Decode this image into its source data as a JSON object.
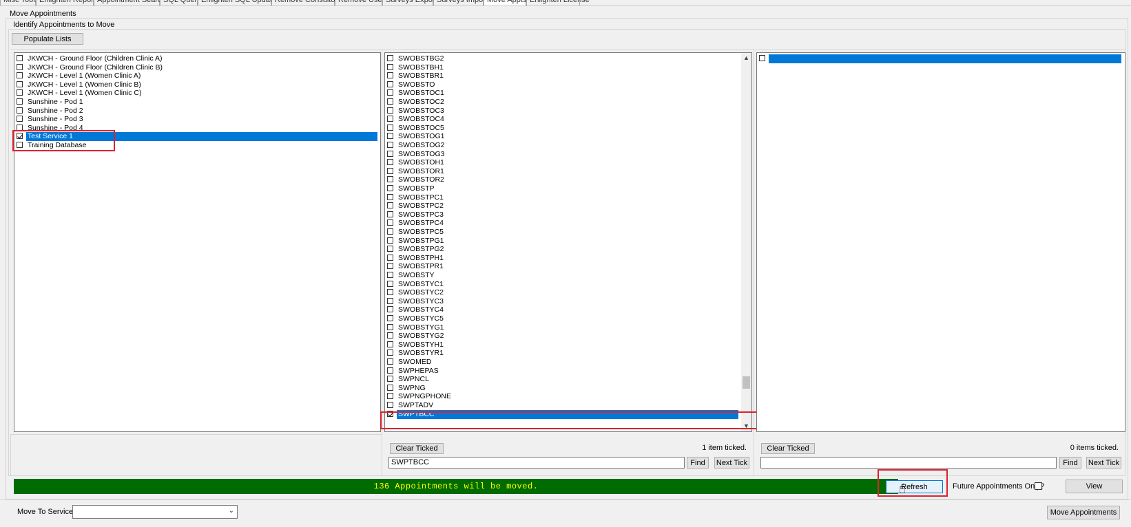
{
  "tabs": [
    {
      "label": "Misc Tools"
    },
    {
      "label": "Enlighten Reports"
    },
    {
      "label": "Appointment Search"
    },
    {
      "label": "SQL Query"
    },
    {
      "label": "Enlighten SQL Updates"
    },
    {
      "label": "Remove Consultors"
    },
    {
      "label": "Remove Users"
    },
    {
      "label": "Surveys Export"
    },
    {
      "label": "Surveys Import"
    },
    {
      "label": "Move Appts"
    },
    {
      "label": "Enlighten License"
    }
  ],
  "outer_group_title": "Move Appointments",
  "inner_group_title": "Identify Appointments to Move",
  "populate_button": "Populate Lists",
  "services": [
    {
      "label": "JKWCH - Ground Floor (Children Clinic A)",
      "checked": false
    },
    {
      "label": "JKWCH - Ground Floor (Children Clinic B)",
      "checked": false
    },
    {
      "label": "JKWCH - Level 1 (Women Clinic A)",
      "checked": false
    },
    {
      "label": "JKWCH - Level 1 (Women Clinic B)",
      "checked": false
    },
    {
      "label": "JKWCH - Level 1 (Women Clinic C)",
      "checked": false
    },
    {
      "label": "Sunshine - Pod 1",
      "checked": false
    },
    {
      "label": "Sunshine - Pod 2",
      "checked": false
    },
    {
      "label": "Sunshine - Pod 3",
      "checked": false
    },
    {
      "label": "Sunshine - Pod 4",
      "checked": false
    },
    {
      "label": "Test Service 1",
      "checked": true,
      "selected": true
    },
    {
      "label": "Training Database",
      "checked": false
    }
  ],
  "clinics": [
    {
      "label": "SWOBSTBG2",
      "checked": false
    },
    {
      "label": "SWOBSTBH1",
      "checked": false
    },
    {
      "label": "SWOBSTBR1",
      "checked": false
    },
    {
      "label": "SWOBSTO",
      "checked": false
    },
    {
      "label": "SWOBSTOC1",
      "checked": false
    },
    {
      "label": "SWOBSTOC2",
      "checked": false
    },
    {
      "label": "SWOBSTOC3",
      "checked": false
    },
    {
      "label": "SWOBSTOC4",
      "checked": false
    },
    {
      "label": "SWOBSTOC5",
      "checked": false
    },
    {
      "label": "SWOBSTOG1",
      "checked": false
    },
    {
      "label": "SWOBSTOG2",
      "checked": false
    },
    {
      "label": "SWOBSTOG3",
      "checked": false
    },
    {
      "label": "SWOBSTOH1",
      "checked": false
    },
    {
      "label": "SWOBSTOR1",
      "checked": false
    },
    {
      "label": "SWOBSTOR2",
      "checked": false
    },
    {
      "label": "SWOBSTP",
      "checked": false
    },
    {
      "label": "SWOBSTPC1",
      "checked": false
    },
    {
      "label": "SWOBSTPC2",
      "checked": false
    },
    {
      "label": "SWOBSTPC3",
      "checked": false
    },
    {
      "label": "SWOBSTPC4",
      "checked": false
    },
    {
      "label": "SWOBSTPC5",
      "checked": false
    },
    {
      "label": "SWOBSTPG1",
      "checked": false
    },
    {
      "label": "SWOBSTPG2",
      "checked": false
    },
    {
      "label": "SWOBSTPH1",
      "checked": false
    },
    {
      "label": "SWOBSTPR1",
      "checked": false
    },
    {
      "label": "SWOBSTY",
      "checked": false
    },
    {
      "label": "SWOBSTYC1",
      "checked": false
    },
    {
      "label": "SWOBSTYC2",
      "checked": false
    },
    {
      "label": "SWOBSTYC3",
      "checked": false
    },
    {
      "label": "SWOBSTYC4",
      "checked": false
    },
    {
      "label": "SWOBSTYC5",
      "checked": false
    },
    {
      "label": "SWOBSTYG1",
      "checked": false
    },
    {
      "label": "SWOBSTYG2",
      "checked": false
    },
    {
      "label": "SWOBSTYH1",
      "checked": false
    },
    {
      "label": "SWOBSTYR1",
      "checked": false
    },
    {
      "label": "SWOMED",
      "checked": false
    },
    {
      "label": "SWPHEPAS",
      "checked": false
    },
    {
      "label": "SWPNCL",
      "checked": false
    },
    {
      "label": "SWPNG",
      "checked": false
    },
    {
      "label": "SWPNGPHONE",
      "checked": false
    },
    {
      "label": "SWPTADV",
      "checked": false
    },
    {
      "label": "SWPTBCC",
      "checked": true,
      "selected": true
    }
  ],
  "consultants": [
    {
      "label": "",
      "checked": false,
      "selected": true
    }
  ],
  "clinics_panel": {
    "clear_label": "Clear Ticked",
    "ticked_count": "1 item ticked.",
    "search_value": "SWPTBCC",
    "find_label": "Find",
    "next_label": "Next Tick"
  },
  "consultants_panel": {
    "clear_label": "Clear Ticked",
    "ticked_count": "0 items ticked.",
    "search_value": "",
    "find_label": "Find",
    "next_label": "Next Tick"
  },
  "status_message": "136 Appointments will be moved.",
  "status_color": "#006b00",
  "refresh_label": "Refresh",
  "future_only_label": "Future Appointments Only?",
  "future_only_checked": false,
  "view_label": "View",
  "move_to_label": "Move To Service",
  "move_to_value": "",
  "move_button": "Move Appointments",
  "accent_color": "#0078d7",
  "highlight_color": "#d9232e"
}
